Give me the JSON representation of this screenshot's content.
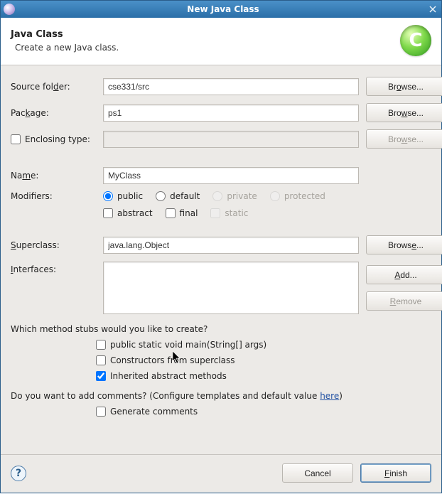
{
  "window": {
    "title": "New Java Class"
  },
  "header": {
    "title": "Java Class",
    "subtitle": "Create a new Java class.",
    "icon_label": "C"
  },
  "labels": {
    "source_folder": "Source folder:",
    "package": "Package:",
    "enclosing_type": "Enclosing type:",
    "name": "Name:",
    "modifiers": "Modifiers:",
    "superclass": "Superclass:",
    "interfaces": "Interfaces:"
  },
  "buttons": {
    "browse": "Browse...",
    "add": "Add...",
    "remove": "Remove",
    "cancel": "Cancel",
    "finish": "Finish"
  },
  "fields": {
    "source_folder": "cse331/src",
    "package": "ps1",
    "enclosing_type": "",
    "name": "MyClass",
    "superclass": "java.lang.Object"
  },
  "modifiers": {
    "access": {
      "public": "public",
      "default": "default",
      "private": "private",
      "protected": "protected"
    },
    "flags": {
      "abstract": "abstract",
      "final": "final",
      "static": "static"
    }
  },
  "stubs_question": "Which method stubs would you like to create?",
  "stubs": {
    "main": "public static void main(String[] args)",
    "constructors": "Constructors from superclass",
    "inherited": "Inherited abstract methods"
  },
  "comments_question_prefix": "Do you want to add comments? (Configure templates and default value ",
  "comments_question_link": "here",
  "comments_question_suffix": ")",
  "generate_comments_label": "Generate comments"
}
